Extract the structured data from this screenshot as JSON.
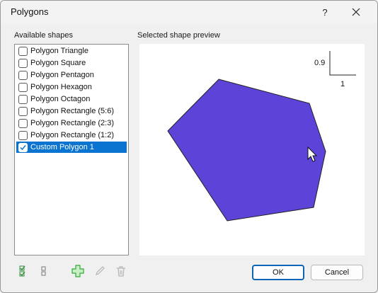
{
  "window": {
    "title": "Polygons",
    "help_glyph": "?"
  },
  "left_panel": {
    "label": "Available shapes",
    "items": [
      {
        "label": "Polygon Triangle",
        "checked": false,
        "selected": false
      },
      {
        "label": "Polygon Square",
        "checked": false,
        "selected": false
      },
      {
        "label": "Polygon Pentagon",
        "checked": false,
        "selected": false
      },
      {
        "label": "Polygon Hexagon",
        "checked": false,
        "selected": false
      },
      {
        "label": "Polygon Octagon",
        "checked": false,
        "selected": false
      },
      {
        "label": "Polygon Rectangle (5:6)",
        "checked": false,
        "selected": false
      },
      {
        "label": "Polygon Rectangle (2:3)",
        "checked": false,
        "selected": false
      },
      {
        "label": "Polygon Rectangle (1:2)",
        "checked": false,
        "selected": false
      },
      {
        "label": "Custom Polygon 1",
        "checked": true,
        "selected": true
      }
    ]
  },
  "preview": {
    "label": "Selected shape preview",
    "scale_y": "0.9",
    "scale_x": "1",
    "fill_color": "#5d43d8"
  },
  "toolbar": {
    "icons": [
      "check-all-icon",
      "uncheck-all-icon",
      "add-icon",
      "edit-icon",
      "delete-icon"
    ]
  },
  "buttons": {
    "ok": "OK",
    "cancel": "Cancel"
  },
  "colors": {
    "selection": "#0a74d0",
    "add_icon": "#34a93a"
  }
}
